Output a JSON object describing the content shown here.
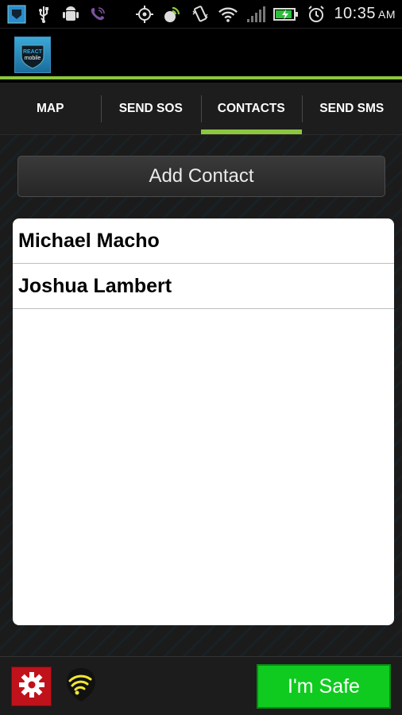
{
  "status_bar": {
    "time": "10:35",
    "ampm": "AM",
    "icons": [
      "react-mobile-app-icon",
      "usb-icon",
      "android-debug-icon",
      "viber-icon",
      "gps-icon",
      "sync-icon",
      "vibrate-icon",
      "wifi-icon",
      "cell-signal-icon",
      "battery-charging-icon",
      "alarm-icon"
    ]
  },
  "app": {
    "logo_line1": "REACT",
    "logo_line2": "mobile",
    "accent": "#8dc63f"
  },
  "tabs": [
    {
      "label": "MAP"
    },
    {
      "label": "SEND SOS"
    },
    {
      "label": "CONTACTS",
      "active": true
    },
    {
      "label": "SEND SMS"
    }
  ],
  "main": {
    "add_contact_label": "Add Contact",
    "contacts": [
      "Michael Macho",
      "Joshua Lambert"
    ]
  },
  "bottom": {
    "settings_icon": "gear-icon",
    "signal_icon": "wifi-signal-icon",
    "safe_label": "I'm Safe",
    "safe_color": "#0fcb1f",
    "settings_color": "#c0121b"
  }
}
